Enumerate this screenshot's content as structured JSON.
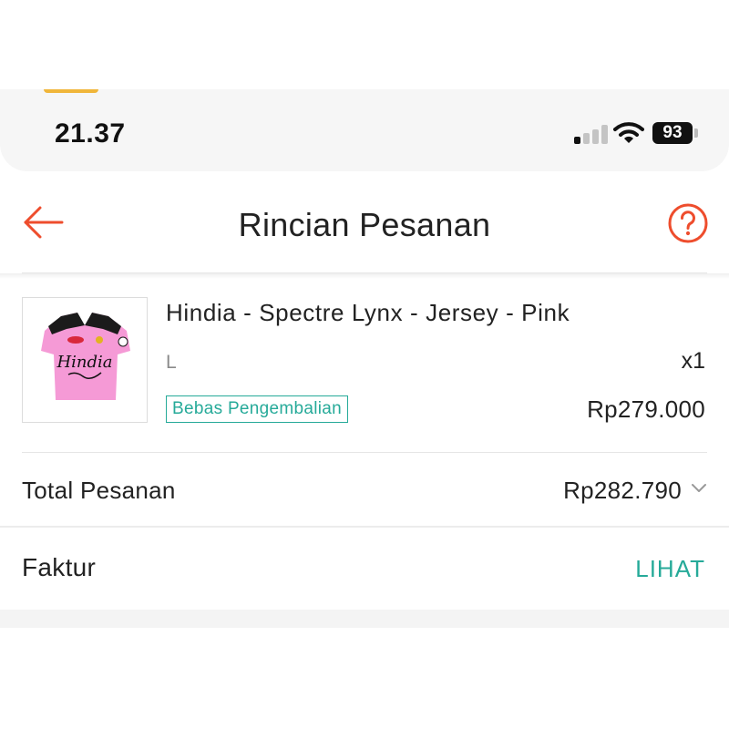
{
  "status_bar": {
    "time": "21.37",
    "battery": "93"
  },
  "header": {
    "title": "Rincian Pesanan",
    "back_icon": "arrow-left-icon",
    "help_icon": "question-circle-icon",
    "accent_color": "#ee4d2d"
  },
  "product": {
    "name": "Hindia - Spectre Lynx - Jersey - Pink",
    "variant": "L",
    "quantity": "x1",
    "badge": "Bebas Pengembalian",
    "price": "Rp279.000",
    "thumbnail_text": "Hindia"
  },
  "order_total": {
    "label": "Total Pesanan",
    "value": "Rp282.790",
    "icon": "chevron-down-icon"
  },
  "invoice": {
    "label": "Faktur",
    "action": "LIHAT",
    "action_color": "#26aa99"
  }
}
